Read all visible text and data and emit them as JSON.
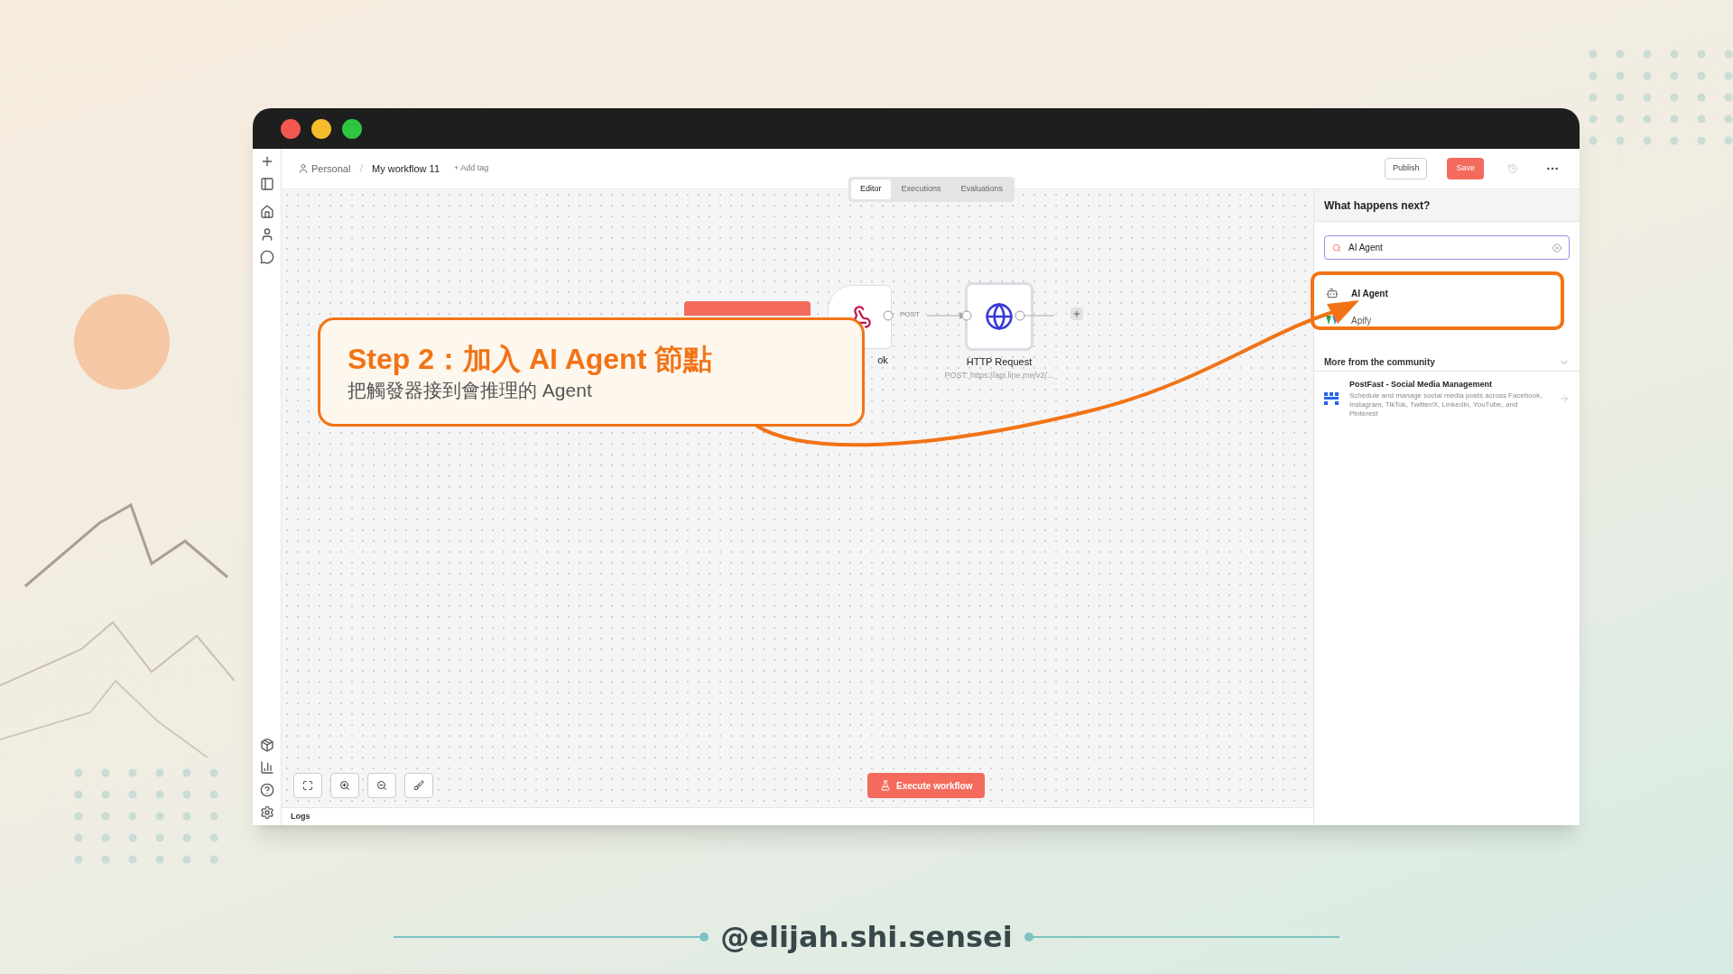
{
  "slide": {
    "handle": "@elijah.shi.sensei"
  },
  "header": {
    "project": "Personal",
    "separator": "/",
    "workflow": "My workflow 11",
    "add_tag": "+ Add tag",
    "publish": "Publish",
    "save": "Save"
  },
  "tabs": [
    {
      "label": "Editor",
      "selected": true
    },
    {
      "label": "Executions",
      "selected": false
    },
    {
      "label": "Evaluations",
      "selected": false
    }
  ],
  "canvas": {
    "nodes": [
      {
        "kind": "webhook",
        "label": "ok"
      },
      {
        "kind": "http",
        "label": "HTTP Request",
        "subtitle": "POST: https://api.line.me/v2/..."
      }
    ],
    "connection_label": "POST",
    "execute_button": "Execute workflow",
    "logs": "Logs"
  },
  "panel": {
    "title": "What happens next?",
    "search": {
      "value": "AI Agent"
    },
    "results": [
      {
        "kind": "agent",
        "label": "AI Agent"
      },
      {
        "kind": "apify",
        "label": "Apify"
      }
    ],
    "community": {
      "title": "More from the community",
      "items": [
        {
          "title": "PostFast - Social Media Management",
          "description": "Schedule and manage social media posts across Facebook, Instagram, TikTok, Twitter/X, LinkedIn, YouTube, and Pinterest"
        }
      ]
    }
  },
  "callout": {
    "title": "Step 2：加入 AI Agent 節點",
    "subtitle": "把觸發器接到會推理的 Agent"
  }
}
